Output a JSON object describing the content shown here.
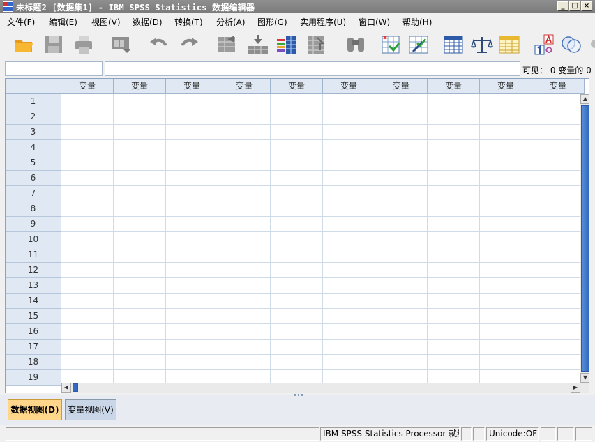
{
  "window": {
    "title": "未标题2 [数据集1] - IBM SPSS Statistics 数据编辑器",
    "minimize": "_",
    "restore": "□",
    "close": "×"
  },
  "menu": [
    "文件(F)",
    "编辑(E)",
    "视图(V)",
    "数据(D)",
    "转换(T)",
    "分析(A)",
    "图形(G)",
    "实用程序(U)",
    "窗口(W)",
    "帮助(H)"
  ],
  "toolbar_icons": [
    "open-folder-icon",
    "save-icon",
    "print-icon",
    "dialog-recall-icon",
    "undo-icon",
    "redo-icon",
    "goto-case-icon",
    "insert-cases-icon",
    "insert-variable-icon",
    "split-file-icon",
    "find-icon",
    "select-cases-icon",
    "weight-cases-icon",
    "variables-icon",
    "scales-icon",
    "value-labels-icon",
    "use-sets-icon",
    "show-all-icon"
  ],
  "editor": {
    "cell_ref": "",
    "cell_value": "",
    "visible_label": "可见： 0 变量的 0"
  },
  "grid": {
    "column_header": "变量",
    "column_count": 10,
    "rows": [
      "1",
      "2",
      "3",
      "4",
      "5",
      "6",
      "7",
      "8",
      "9",
      "10",
      "11",
      "12",
      "13",
      "14",
      "15",
      "16",
      "17",
      "18",
      "19"
    ]
  },
  "tabs": {
    "data_view": "数据视图(D)",
    "variable_view": "变量视图(V)"
  },
  "status": {
    "processor": "IBM SPSS Statistics Processor 就绪",
    "unicode": "Unicode:OFF"
  },
  "colors": {
    "accent": "#2f6ac4",
    "header_bg": "#dfe8f3",
    "active_tab": "#ffd68a"
  }
}
